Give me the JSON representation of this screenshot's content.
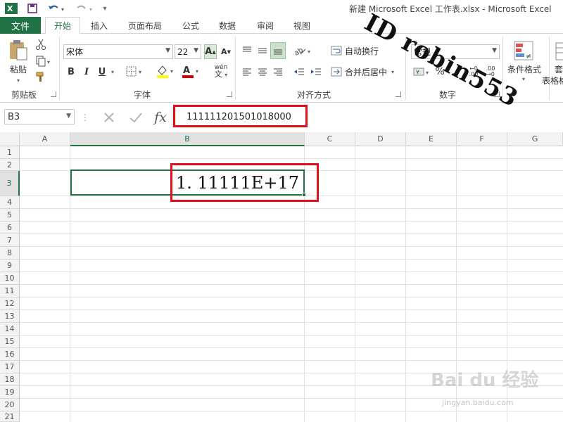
{
  "window": {
    "title": "新建 Microsoft Excel 工作表.xlsx - Microsoft Excel"
  },
  "tabs": [
    "文件",
    "开始",
    "插入",
    "页面布局",
    "公式",
    "数据",
    "审阅",
    "视图"
  ],
  "ribbon": {
    "clipboard": {
      "paste": "粘贴",
      "group": "剪贴板"
    },
    "font": {
      "name": "宋体",
      "size": "22",
      "bold": "B",
      "italic": "I",
      "underline": "U",
      "font_color_letter": "A",
      "pinyin": "wén",
      "group": "字体"
    },
    "alignment": {
      "wrap": "自动换行",
      "merge": "合并后居中",
      "group": "对齐方式"
    },
    "number": {
      "format": "常规",
      "percent": "%",
      "group": "数字"
    },
    "styles": {
      "conditional": "条件格式",
      "table_a": "套",
      "table_b": "表格格"
    }
  },
  "formula_bar": {
    "name_box": "B3",
    "fx": "fx",
    "content": "111111201501018000"
  },
  "grid": {
    "columns": [
      "A",
      "B",
      "C",
      "D",
      "E",
      "F",
      "G"
    ],
    "rows": [
      "1",
      "2",
      "3",
      "4",
      "5",
      "6",
      "7",
      "8",
      "9",
      "10",
      "11",
      "12",
      "13",
      "14",
      "15",
      "16",
      "17",
      "18",
      "19",
      "20",
      "21"
    ],
    "selected_cell_display": "1. 11111E+17"
  },
  "watermark": {
    "id_text": "ID robin553",
    "baidu": "Bai du 经验",
    "url": "jingyan.baidu.com"
  },
  "colors": {
    "excel_green": "#217346",
    "highlight_red": "#e0101a"
  }
}
